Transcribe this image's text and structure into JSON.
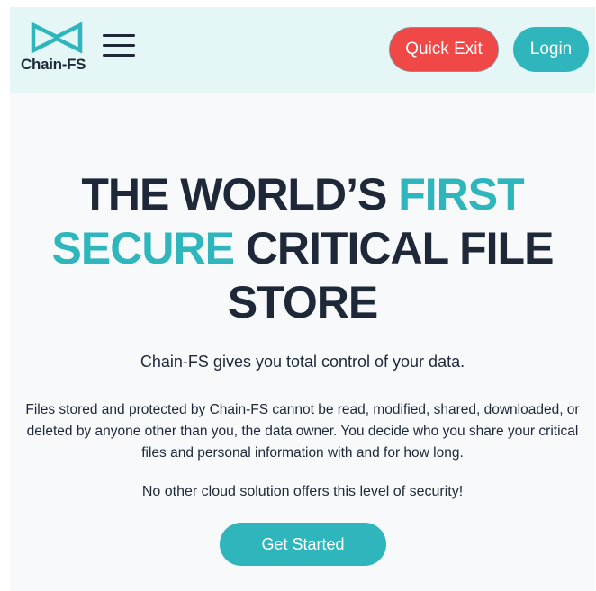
{
  "colors": {
    "accent": "#2fb6bd",
    "danger": "#f04747",
    "dark_text": "#1e2838",
    "header_bg": "#e5f6f7"
  },
  "header": {
    "logo_text": "Chain-FS",
    "logo_icon": "chain-fs-bowtie-logo",
    "menu_icon": "hamburger-menu-icon",
    "quick_exit_label": "Quick Exit",
    "login_label": "Login"
  },
  "hero": {
    "title_part1": "THE WORLD’S ",
    "title_highlight1": "FIRST SECURE",
    "title_part2": " CRITICAL FILE STORE",
    "tagline": "Chain-FS gives you total control of your data.",
    "description": "Files stored and protected by Chain-FS cannot be read, modified, shared, downloaded, or deleted by anyone other than you, the data owner. You decide who you share your critical files and personal information with and for how long.",
    "closing": "No other cloud solution offers this level of security!",
    "cta_label": "Get Started"
  }
}
